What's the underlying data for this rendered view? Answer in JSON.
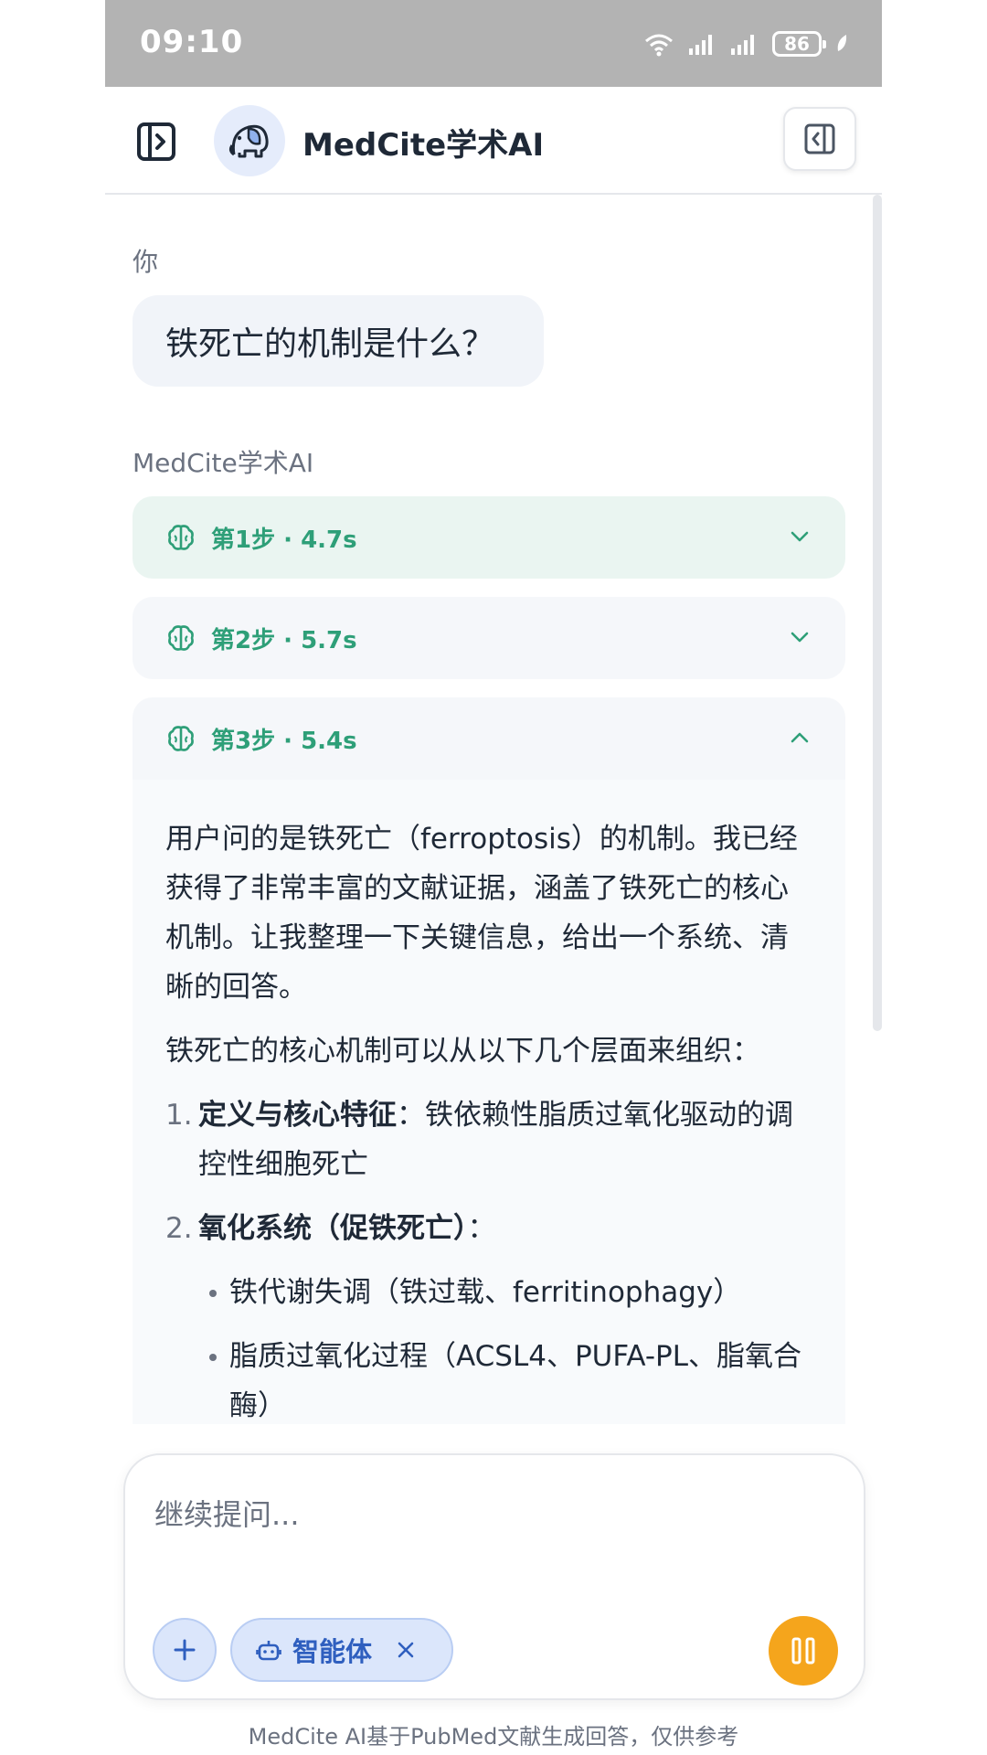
{
  "status_bar": {
    "time": "09:10",
    "battery": "86"
  },
  "header": {
    "title": "MedCite学术AI"
  },
  "chat": {
    "user_label": "你",
    "user_message": "铁死亡的机制是什么？",
    "assistant_label": "MedCite学术AI",
    "steps": [
      {
        "label": "第1步 · 4.7s",
        "state": "collapsed"
      },
      {
        "label": "第2步 · 5.7s",
        "state": "collapsed"
      },
      {
        "label": "第3步 · 5.4s",
        "state": "expanded"
      }
    ],
    "step3_body": {
      "para1": "用户问的是铁死亡（ferroptosis）的机制。我已经获得了非常丰富的文献证据，涵盖了铁死亡的核心机制。让我整理一下关键信息，给出一个系统、清晰的回答。",
      "para2": "铁死亡的核心机制可以从以下几个层面来组织：",
      "list": [
        {
          "num": "1.",
          "bold": "定义与核心特征",
          "text": "：铁依赖性脂质过氧化驱动的调控性细胞死亡"
        },
        {
          "num": "2.",
          "bold": "氧化系统（促铁死亡）",
          "text": "："
        }
      ],
      "bullets": [
        "铁代谢失调（铁过载、ferritinophagy）",
        "脂质过氧化过程（ACSL4、PUFA-PL、脂氧合酶）"
      ]
    }
  },
  "composer": {
    "placeholder": "继续提问...",
    "agent_chip_label": "智能体"
  },
  "footer": {
    "disclaimer": "MedCite AI基于PubMed文献生成回答，仅供参考"
  },
  "colors": {
    "accent_green": "#2e9f78",
    "accent_blue": "#2f5fbf",
    "pause_orange": "#f5a51c"
  }
}
